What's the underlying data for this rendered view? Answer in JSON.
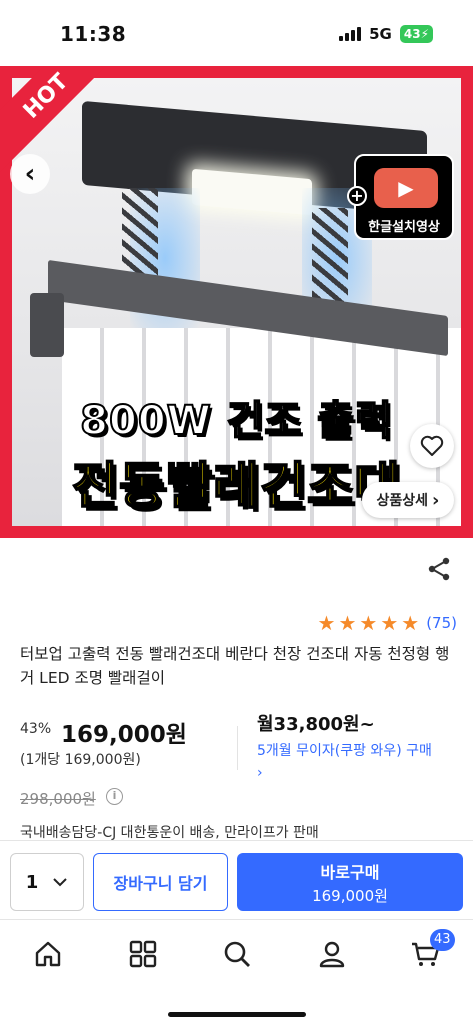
{
  "status_bar": {
    "time": "11:38",
    "network": "5G",
    "battery": "43"
  },
  "hero": {
    "ribbon": "HOT",
    "video_badge_label": "한글설치영상",
    "headline_1": "800W 건조 출력",
    "headline_2": "전동빨래건조대",
    "detail_button": "상품상세"
  },
  "product": {
    "rating_stars": 5,
    "review_count": "(75)",
    "title": "터보업 고출력 전동 빨래건조대 베란다 천장 건조대 자동 천정형 행거 LED 조명 빨래걸이",
    "discount": "43%",
    "price": "169,000원",
    "unit_price": "(1개당 169,000원)",
    "monthly_price": "월33,800원~",
    "installment": "5개월 무이자(쿠팡 와우) 구매",
    "original_price": "298,000원",
    "shipping": "국내배송담당-CJ 대한통운이 배송, 만라이프가 판매"
  },
  "buy_bar": {
    "quantity": "1",
    "cart_button": "장바구니 담기",
    "buy_button": "바로구매",
    "buy_price": "169,000원"
  },
  "tab_bar": {
    "cart_count": "43"
  },
  "colors": {
    "accent": "#346aff",
    "star": "#f58a2a",
    "hero_border": "#e8233d"
  }
}
